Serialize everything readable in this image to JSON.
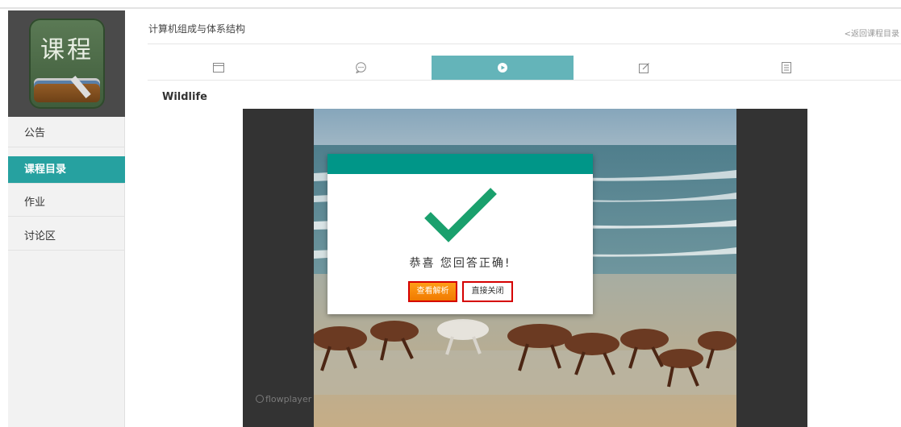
{
  "app": {
    "logo_text": "课程"
  },
  "sidebar": {
    "items": [
      {
        "label": "公告"
      },
      {
        "label": "课程目录"
      },
      {
        "label": "作业"
      },
      {
        "label": "讨论区"
      }
    ]
  },
  "header": {
    "course_title": "计算机组成与体系结构",
    "back_link": "<返回课程目录"
  },
  "tabs": [
    {
      "icon": "window-icon"
    },
    {
      "icon": "chat-bubble-icon"
    },
    {
      "icon": "play-circle-icon",
      "active": true
    },
    {
      "icon": "edit-icon"
    },
    {
      "icon": "document-icon"
    }
  ],
  "video": {
    "title": "Wildlife",
    "watermark": "flowplayer"
  },
  "modal": {
    "message": "恭喜 您回答正确!",
    "analysis_button": "查看解析",
    "close_button": "直接关闭",
    "header_color": "#009688",
    "check_color": "#1aa06d"
  },
  "colors": {
    "accent": "#26a1a0",
    "active_tab": "#64b4b9"
  }
}
